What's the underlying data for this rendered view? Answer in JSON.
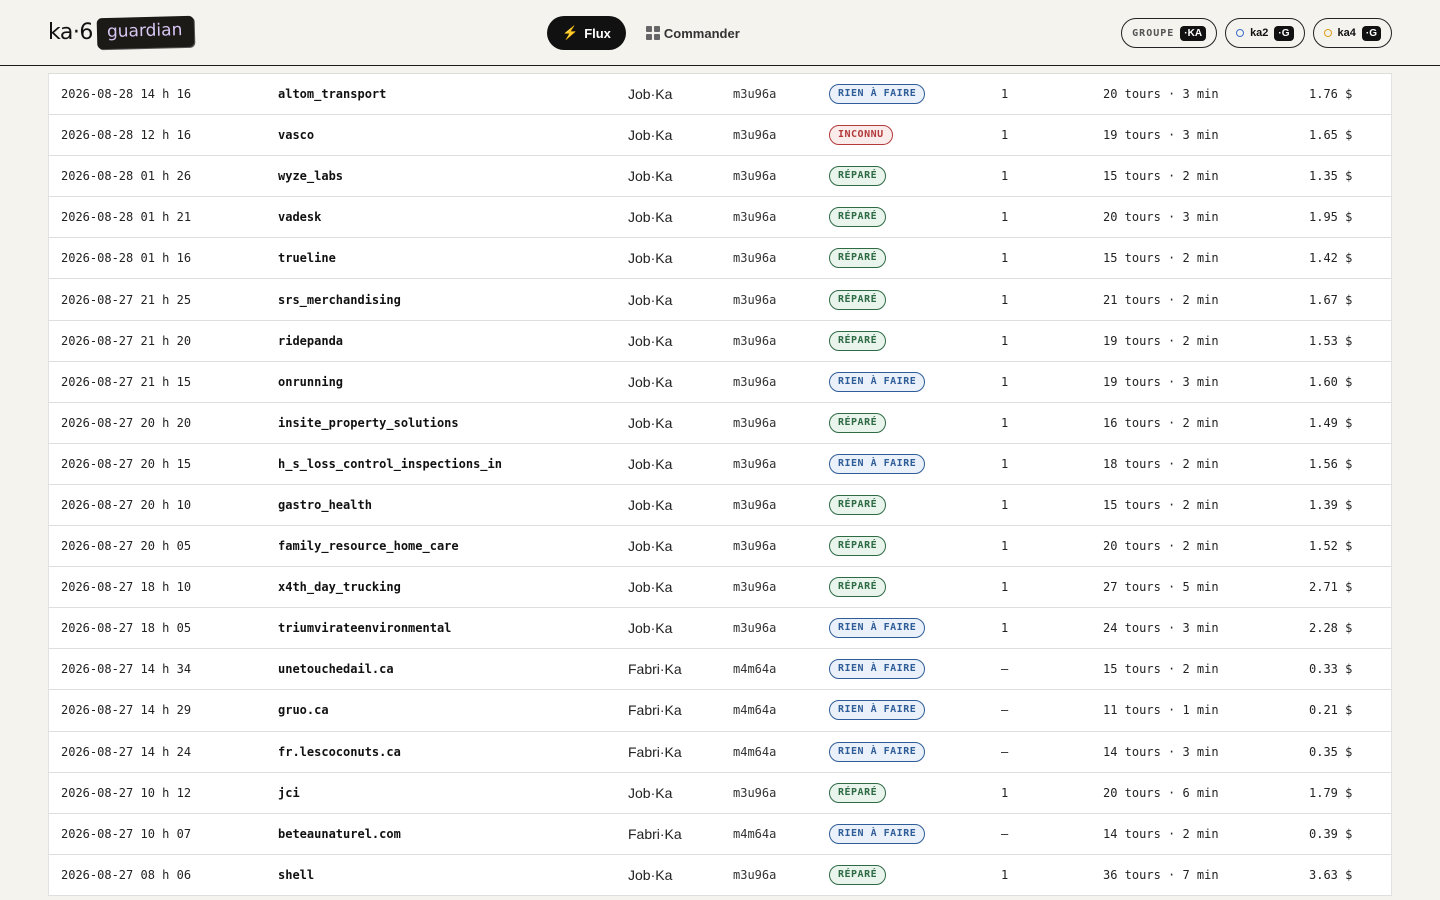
{
  "header": {
    "brand": "ka·6",
    "brand_tag": "guardian",
    "nav": {
      "flux": "Flux",
      "commander": "Commander"
    },
    "chips": [
      {
        "label": "GROUPE",
        "tag": "·KA"
      },
      {
        "label": "ka2",
        "tag": "·G",
        "dot_color": "#3c6fcf"
      },
      {
        "label": "ka4",
        "tag": "·G",
        "dot_color": "#e0a020"
      }
    ]
  },
  "colors": {
    "accent": "#111111",
    "rien": "#2f5d97",
    "repare": "#2e6b45",
    "inconnu": "#b23a3a"
  },
  "rows": [
    {
      "date": "2026-08-28 14 h 16",
      "name": "altom_transport",
      "agent": "Job·Ka",
      "model": "m3u96a",
      "status": "RIEN À FAIRE",
      "kind": "rien",
      "count": "1",
      "turns": "20 tours · 3 min",
      "cost": "1.76 $"
    },
    {
      "date": "2026-08-28 12 h 16",
      "name": "vasco",
      "agent": "Job·Ka",
      "model": "m3u96a",
      "status": "INCONNU",
      "kind": "inconnu",
      "count": "1",
      "turns": "19 tours · 3 min",
      "cost": "1.65 $"
    },
    {
      "date": "2026-08-28 01 h 26",
      "name": "wyze_labs",
      "agent": "Job·Ka",
      "model": "m3u96a",
      "status": "RÉPARÉ",
      "kind": "repare",
      "count": "1",
      "turns": "15 tours · 2 min",
      "cost": "1.35 $"
    },
    {
      "date": "2026-08-28 01 h 21",
      "name": "vadesk",
      "agent": "Job·Ka",
      "model": "m3u96a",
      "status": "RÉPARÉ",
      "kind": "repare",
      "count": "1",
      "turns": "20 tours · 3 min",
      "cost": "1.95 $"
    },
    {
      "date": "2026-08-28 01 h 16",
      "name": "trueline",
      "agent": "Job·Ka",
      "model": "m3u96a",
      "status": "RÉPARÉ",
      "kind": "repare",
      "count": "1",
      "turns": "15 tours · 2 min",
      "cost": "1.42 $"
    },
    {
      "date": "2026-08-27 21 h 25",
      "name": "srs_merchandising",
      "agent": "Job·Ka",
      "model": "m3u96a",
      "status": "RÉPARÉ",
      "kind": "repare",
      "count": "1",
      "turns": "21 tours · 2 min",
      "cost": "1.67 $"
    },
    {
      "date": "2026-08-27 21 h 20",
      "name": "ridepanda",
      "agent": "Job·Ka",
      "model": "m3u96a",
      "status": "RÉPARÉ",
      "kind": "repare",
      "count": "1",
      "turns": "19 tours · 2 min",
      "cost": "1.53 $"
    },
    {
      "date": "2026-08-27 21 h 15",
      "name": "onrunning",
      "agent": "Job·Ka",
      "model": "m3u96a",
      "status": "RIEN À FAIRE",
      "kind": "rien",
      "count": "1",
      "turns": "19 tours · 3 min",
      "cost": "1.60 $"
    },
    {
      "date": "2026-08-27 20 h 20",
      "name": "insite_property_solutions",
      "agent": "Job·Ka",
      "model": "m3u96a",
      "status": "RÉPARÉ",
      "kind": "repare",
      "count": "1",
      "turns": "16 tours · 2 min",
      "cost": "1.49 $"
    },
    {
      "date": "2026-08-27 20 h 15",
      "name": "h_s_loss_control_inspections_in",
      "agent": "Job·Ka",
      "model": "m3u96a",
      "status": "RIEN À FAIRE",
      "kind": "rien",
      "count": "1",
      "turns": "18 tours · 2 min",
      "cost": "1.56 $"
    },
    {
      "date": "2026-08-27 20 h 10",
      "name": "gastro_health",
      "agent": "Job·Ka",
      "model": "m3u96a",
      "status": "RÉPARÉ",
      "kind": "repare",
      "count": "1",
      "turns": "15 tours · 2 min",
      "cost": "1.39 $"
    },
    {
      "date": "2026-08-27 20 h 05",
      "name": "family_resource_home_care",
      "agent": "Job·Ka",
      "model": "m3u96a",
      "status": "RÉPARÉ",
      "kind": "repare",
      "count": "1",
      "turns": "20 tours · 2 min",
      "cost": "1.52 $"
    },
    {
      "date": "2026-08-27 18 h 10",
      "name": "x4th_day_trucking",
      "agent": "Job·Ka",
      "model": "m3u96a",
      "status": "RÉPARÉ",
      "kind": "repare",
      "count": "1",
      "turns": "27 tours · 5 min",
      "cost": "2.71 $"
    },
    {
      "date": "2026-08-27 18 h 05",
      "name": "triumvirateenvironmental",
      "agent": "Job·Ka",
      "model": "m3u96a",
      "status": "RIEN À FAIRE",
      "kind": "rien",
      "count": "1",
      "turns": "24 tours · 3 min",
      "cost": "2.28 $"
    },
    {
      "date": "2026-08-27 14 h 34",
      "name": "unetouchedail.ca",
      "agent": "Fabri·Ka",
      "model": "m4m64a",
      "status": "RIEN À FAIRE",
      "kind": "rien",
      "count": "—",
      "turns": "15 tours · 2 min",
      "cost": "0.33 $"
    },
    {
      "date": "2026-08-27 14 h 29",
      "name": "gruo.ca",
      "agent": "Fabri·Ka",
      "model": "m4m64a",
      "status": "RIEN À FAIRE",
      "kind": "rien",
      "count": "—",
      "turns": "11 tours · 1 min",
      "cost": "0.21 $"
    },
    {
      "date": "2026-08-27 14 h 24",
      "name": "fr.lescoconuts.ca",
      "agent": "Fabri·Ka",
      "model": "m4m64a",
      "status": "RIEN À FAIRE",
      "kind": "rien",
      "count": "—",
      "turns": "14 tours · 3 min",
      "cost": "0.35 $"
    },
    {
      "date": "2026-08-27 10 h 12",
      "name": "jci",
      "agent": "Job·Ka",
      "model": "m3u96a",
      "status": "RÉPARÉ",
      "kind": "repare",
      "count": "1",
      "turns": "20 tours · 6 min",
      "cost": "1.79 $"
    },
    {
      "date": "2026-08-27 10 h 07",
      "name": "beteaunaturel.com",
      "agent": "Fabri·Ka",
      "model": "m4m64a",
      "status": "RIEN À FAIRE",
      "kind": "rien",
      "count": "—",
      "turns": "14 tours · 2 min",
      "cost": "0.39 $"
    },
    {
      "date": "2026-08-27 08 h 06",
      "name": "shell",
      "agent": "Job·Ka",
      "model": "m3u96a",
      "status": "RÉPARÉ",
      "kind": "repare",
      "count": "1",
      "turns": "36 tours · 7 min",
      "cost": "3.63 $"
    }
  ]
}
